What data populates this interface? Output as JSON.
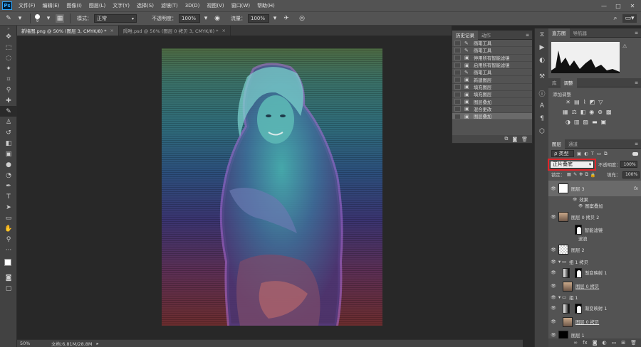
{
  "app": {
    "logo": "Ps"
  },
  "menubar": {
    "items": [
      "文件(F)",
      "编辑(E)",
      "图像(I)",
      "图层(L)",
      "文字(Y)",
      "选择(S)",
      "滤镜(T)",
      "3D(D)",
      "视图(V)",
      "窗口(W)",
      "帮助(H)"
    ],
    "window_controls": [
      "—",
      "□",
      "✕"
    ]
  },
  "options_bar": {
    "brush_size": "9",
    "mode_label": "模式：",
    "mode_value": "正常",
    "opacity_label": "不透明度：",
    "opacity_value": "100%",
    "flow_label": "流量：",
    "flow_value": "100%"
  },
  "doc_tabs": [
    {
      "label": "新墙图.png @ 50% (图层 3, CMYK/8) *",
      "active": true
    },
    {
      "label": "隔唯.psd @ 50% (图层 0 拷贝 3, CMYK/8) *",
      "active": false
    }
  ],
  "status": {
    "zoom": "50%",
    "doc": "文档:6.81M/28.8M"
  },
  "history": {
    "tabs": [
      "历史记录",
      "动作"
    ],
    "items": [
      {
        "label": "画笔工具",
        "icon": "brush-icon"
      },
      {
        "label": "画笔工具",
        "icon": "brush-icon"
      },
      {
        "label": "停用所有智能滤镜",
        "icon": "layer-icon"
      },
      {
        "label": "启用所有智能滤镜",
        "icon": "layer-icon"
      },
      {
        "label": "画笔工具",
        "icon": "brush-icon"
      },
      {
        "label": "新建图层",
        "icon": "layer-icon"
      },
      {
        "label": "填充图层",
        "icon": "layer-icon"
      },
      {
        "label": "填充图层",
        "icon": "layer-icon"
      },
      {
        "label": "图层叠加",
        "icon": "layer-icon"
      },
      {
        "label": "混合更改",
        "icon": "layer-icon"
      },
      {
        "label": "图层叠加",
        "icon": "layer-icon"
      }
    ],
    "selected_index": 10
  },
  "histogram": {
    "tabs": [
      "直方图",
      "导航器"
    ]
  },
  "adjustments": {
    "tabs": [
      "库",
      "调整"
    ],
    "add_label": "添加调整"
  },
  "layers_panel": {
    "tabs": [
      "图层",
      "通道"
    ],
    "kind_label": "ρ 类型",
    "blend_mode": "正片叠底",
    "opacity_label": "不透明度：",
    "opacity_value": "100%",
    "lock_label": "锁定：",
    "fill_label": "填充：",
    "fill_value": "100%",
    "layers": [
      {
        "name": "图层 3",
        "kind": "layer",
        "fx": "fx",
        "selected": true
      },
      {
        "name": "效果",
        "kind": "effect-group"
      },
      {
        "name": "图案叠加",
        "kind": "effect"
      },
      {
        "name": "图层 0 拷贝 2",
        "kind": "smart"
      },
      {
        "name": "智能滤镜",
        "kind": "smart-filter"
      },
      {
        "name": "波浪",
        "kind": "filter"
      },
      {
        "name": "图层 2",
        "kind": "layer"
      },
      {
        "name": "组 1 拷贝",
        "kind": "group"
      },
      {
        "name": "渐变映射 1",
        "kind": "adjust"
      },
      {
        "name": "图层 0 拷贝",
        "kind": "photo"
      },
      {
        "name": "组 1",
        "kind": "group"
      },
      {
        "name": "渐变映射 1",
        "kind": "adjust"
      },
      {
        "name": "图层 0 拷贝",
        "kind": "photo"
      },
      {
        "name": "图层 1",
        "kind": "black"
      }
    ]
  },
  "colors": {
    "ui_bg": "#535353",
    "highlight": "#e0252a"
  }
}
